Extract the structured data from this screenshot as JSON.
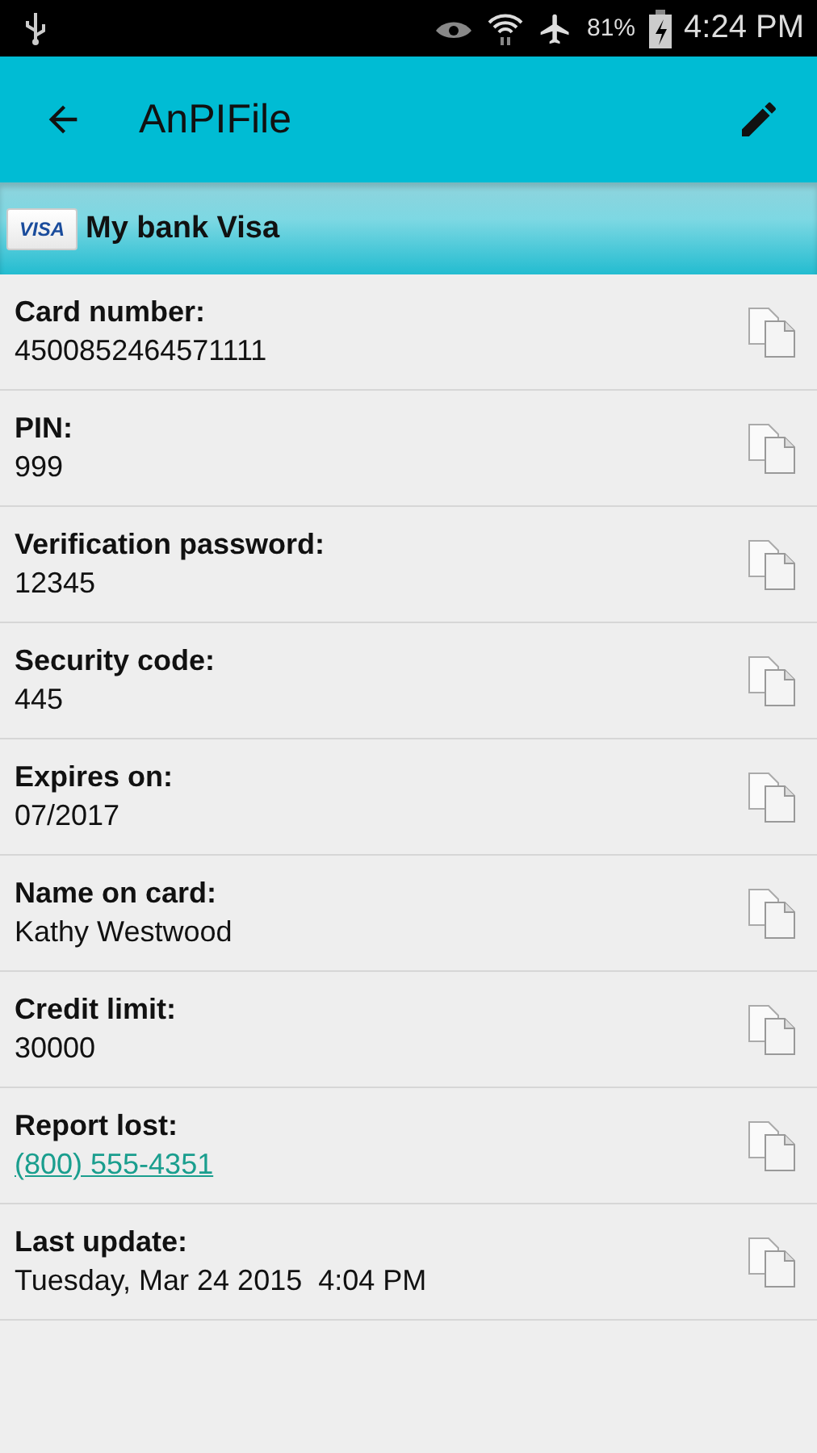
{
  "status_bar": {
    "battery": "81%",
    "time": "4:24 PM"
  },
  "app_bar": {
    "title": "AnPIFile"
  },
  "card_header": {
    "logo": "VISA",
    "title": "My bank Visa"
  },
  "fields": [
    {
      "label": "Card number:",
      "value": "4500852464571111",
      "kind": "text"
    },
    {
      "label": "PIN:",
      "value": "999",
      "kind": "text"
    },
    {
      "label": "Verification password:",
      "value": "12345",
      "kind": "text"
    },
    {
      "label": "Security code:",
      "value": "445",
      "kind": "text"
    },
    {
      "label": "Expires on:",
      "value": "07/2017",
      "kind": "text"
    },
    {
      "label": "Name on card:",
      "value": "Kathy Westwood",
      "kind": "text"
    },
    {
      "label": "Credit limit:",
      "value": "30000",
      "kind": "text"
    },
    {
      "label": "Report lost:",
      "value": "(800) 555-4351",
      "kind": "link"
    },
    {
      "label": "Last update:",
      "value": "Tuesday, Mar 24 2015  4:04 PM",
      "kind": "text"
    }
  ]
}
